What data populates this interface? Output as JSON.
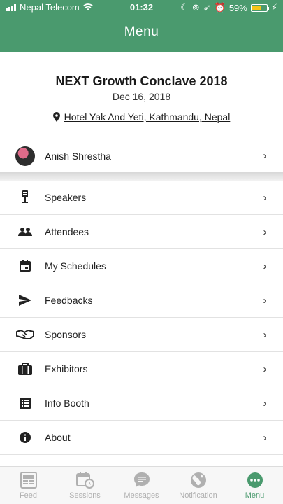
{
  "status_bar": {
    "carrier": "Nepal Telecom",
    "time": "01:32",
    "battery": "59%"
  },
  "header": {
    "title": "Menu"
  },
  "event": {
    "name": "NEXT Growth Conclave 2018",
    "date": "Dec 16, 2018",
    "venue": "Hotel Yak And Yeti, Kathmandu, Nepal"
  },
  "profile": {
    "name": "Anish Shrestha"
  },
  "menu": {
    "items": [
      {
        "label": "Speakers",
        "icon": "microphone-icon"
      },
      {
        "label": "Attendees",
        "icon": "people-icon"
      },
      {
        "label": "My Schedules",
        "icon": "calendar-icon"
      },
      {
        "label": "Feedbacks",
        "icon": "send-icon"
      },
      {
        "label": "Sponsors",
        "icon": "handshake-icon"
      },
      {
        "label": "Exhibitors",
        "icon": "briefcase-icon"
      },
      {
        "label": "Info Booth",
        "icon": "list-icon"
      },
      {
        "label": "About",
        "icon": "info-icon"
      }
    ]
  },
  "tabbar": {
    "tabs": [
      {
        "label": "Feed",
        "icon": "feed-icon"
      },
      {
        "label": "Sessions",
        "icon": "calendar-clock-icon"
      },
      {
        "label": "Messages",
        "icon": "chat-bubble-icon"
      },
      {
        "label": "Notification",
        "icon": "globe-icon"
      },
      {
        "label": "Menu",
        "icon": "more-dots-icon"
      }
    ],
    "active": "Menu"
  },
  "colors": {
    "brand": "#4a9a6e",
    "inactive_tab": "#b0b0b0",
    "battery": "#f5c518"
  }
}
